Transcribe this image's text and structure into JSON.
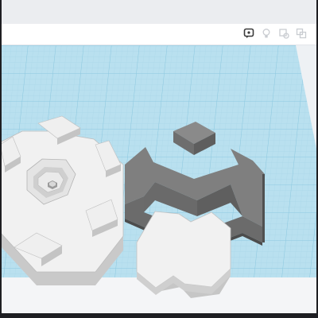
{
  "app": {
    "title": "",
    "viewport": "workplane-3d-view"
  },
  "toolbar": {
    "icons": [
      {
        "name": "note-icon",
        "active": true
      },
      {
        "name": "light-bulb-icon",
        "active": false
      },
      {
        "name": "shape-outline-icon",
        "active": false
      },
      {
        "name": "group-icon",
        "active": false
      }
    ]
  },
  "colors": {
    "workplane": "#b9e0ef",
    "grid_major": "#8dc9e0",
    "grid_minor": "#a9d6e8",
    "shape_light_top": "#f2f2f2",
    "shape_light_side": "#c7c7c7",
    "shape_dark_top": "#7a7a7a",
    "shape_dark_side": "#5c5c5c"
  },
  "scene": {
    "objects": [
      {
        "name": "hexagon-base-with-notches",
        "kind": "light"
      },
      {
        "name": "hexagon-center-cavity",
        "kind": "light"
      },
      {
        "name": "w-shaped-bracket",
        "kind": "dark"
      },
      {
        "name": "double-hexagon-plate",
        "kind": "light"
      }
    ]
  }
}
